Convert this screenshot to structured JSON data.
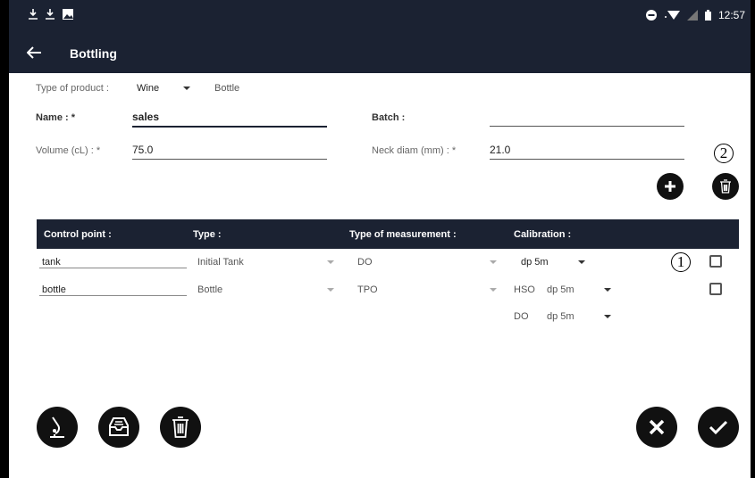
{
  "status_bar": {
    "time": "12:57"
  },
  "header": {
    "title": "Bottling"
  },
  "form": {
    "type_of_product_label": "Type of product :",
    "product_value": "Wine",
    "container_value": "Bottle",
    "name_label": "Name : *",
    "name_value": "sales",
    "batch_label": "Batch :",
    "batch_value": "",
    "volume_label": "Volume (cL) : *",
    "volume_value": "75.0",
    "neck_label": "Neck diam (mm) : *",
    "neck_value": "21.0"
  },
  "annotations": {
    "one": "1",
    "two": "2"
  },
  "table": {
    "headers": [
      "Control point :",
      "Type :",
      "Type of measurement :",
      "Calibration :"
    ],
    "rows": [
      {
        "control_point": "tank",
        "type": "Initial Tank",
        "measurement": "DO",
        "calibration": "dp 5m"
      },
      {
        "control_point": "bottle",
        "type": "Bottle",
        "measurement": "TPO",
        "cal_label_1": "HSO",
        "cal_value_1": "dp 5m",
        "cal_label_2": "DO",
        "cal_value_2": "dp 5m"
      }
    ]
  },
  "colors": {
    "appbar": "#1b2232",
    "button": "#111111"
  }
}
